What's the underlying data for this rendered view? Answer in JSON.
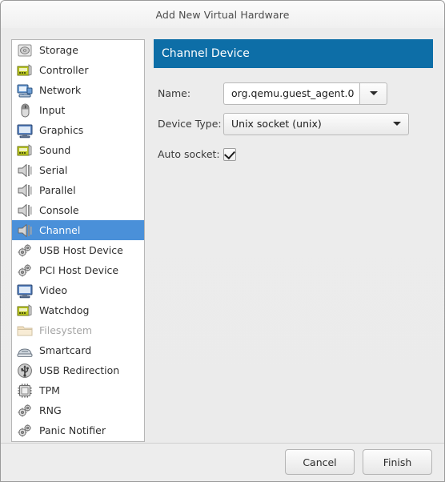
{
  "window": {
    "title": "Add New Virtual Hardware"
  },
  "sidebar": {
    "items": [
      {
        "label": "Storage",
        "icon": "storage-icon",
        "selected": false,
        "disabled": false
      },
      {
        "label": "Controller",
        "icon": "controller-card-icon",
        "selected": false,
        "disabled": false
      },
      {
        "label": "Network",
        "icon": "network-icon",
        "selected": false,
        "disabled": false
      },
      {
        "label": "Input",
        "icon": "mouse-icon",
        "selected": false,
        "disabled": false
      },
      {
        "label": "Graphics",
        "icon": "display-icon",
        "selected": false,
        "disabled": false
      },
      {
        "label": "Sound",
        "icon": "sound-card-icon",
        "selected": false,
        "disabled": false
      },
      {
        "label": "Serial",
        "icon": "serial-port-icon",
        "selected": false,
        "disabled": false
      },
      {
        "label": "Parallel",
        "icon": "serial-port-icon",
        "selected": false,
        "disabled": false
      },
      {
        "label": "Console",
        "icon": "serial-port-icon",
        "selected": false,
        "disabled": false
      },
      {
        "label": "Channel",
        "icon": "serial-port-icon",
        "selected": true,
        "disabled": false
      },
      {
        "label": "USB Host Device",
        "icon": "gears-icon",
        "selected": false,
        "disabled": false
      },
      {
        "label": "PCI Host Device",
        "icon": "gears-icon",
        "selected": false,
        "disabled": false
      },
      {
        "label": "Video",
        "icon": "display-icon",
        "selected": false,
        "disabled": false
      },
      {
        "label": "Watchdog",
        "icon": "controller-card-icon",
        "selected": false,
        "disabled": false
      },
      {
        "label": "Filesystem",
        "icon": "folder-icon",
        "selected": false,
        "disabled": true
      },
      {
        "label": "Smartcard",
        "icon": "smartcard-icon",
        "selected": false,
        "disabled": false
      },
      {
        "label": "USB Redirection",
        "icon": "usb-icon",
        "selected": false,
        "disabled": false
      },
      {
        "label": "TPM",
        "icon": "chip-icon",
        "selected": false,
        "disabled": false
      },
      {
        "label": "RNG",
        "icon": "gears-icon",
        "selected": false,
        "disabled": false
      },
      {
        "label": "Panic Notifier",
        "icon": "gears-icon",
        "selected": false,
        "disabled": false
      }
    ]
  },
  "pane": {
    "header": "Channel Device",
    "fields": {
      "name_label": "Name:",
      "name_value": "org.qemu.guest_agent.0",
      "device_type_label": "Device Type:",
      "device_type_value": "Unix socket (unix)",
      "auto_socket_label": "Auto socket:",
      "auto_socket_checked": true
    }
  },
  "footer": {
    "cancel_label": "Cancel",
    "finish_label": "Finish"
  },
  "colors": {
    "header_blue": "#0d6ea7",
    "selection_blue": "#4a90d9",
    "window_bg": "#ebebeb"
  }
}
